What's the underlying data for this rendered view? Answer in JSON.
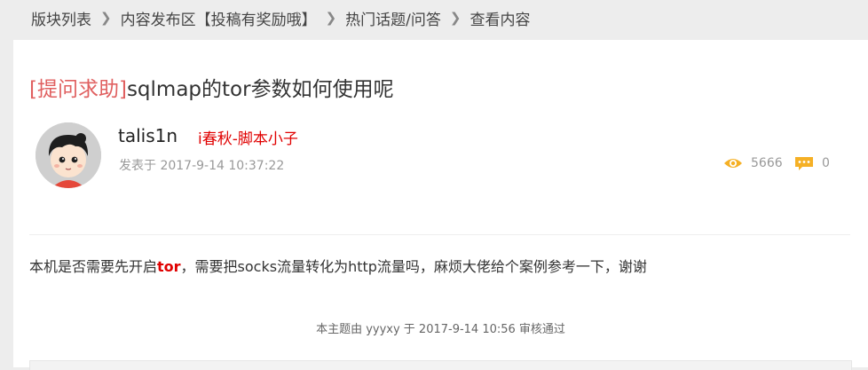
{
  "breadcrumb": [
    {
      "label": "版块列表"
    },
    {
      "label": "内容发布区【投稿有奖励哦】"
    },
    {
      "label": "热门话题/问答"
    },
    {
      "label": "查看内容"
    }
  ],
  "post": {
    "category": "[提问求助]",
    "title": "sqlmap的tor参数如何使用呢",
    "author": "talis1n",
    "group": "i春秋-脚本小子",
    "posted": "发表于 2017-9-14 10:37:22",
    "views": "5666",
    "replies": "0",
    "content_before": "本机是否需要先开启",
    "content_keyword": "tor",
    "content_after": "，需要把socks流量转化为http流量吗，麻烦大佬给个案例参考一下，谢谢",
    "audit_note": "本主题由 yyyxy 于 2017-9-14 10:56 审核通过"
  },
  "colors": {
    "accent_icon": "#f5b025",
    "category": "#e06060",
    "highlight": "#e00000"
  },
  "icons": [
    "chevron-right-icon",
    "eye-icon",
    "comment-icon"
  ]
}
